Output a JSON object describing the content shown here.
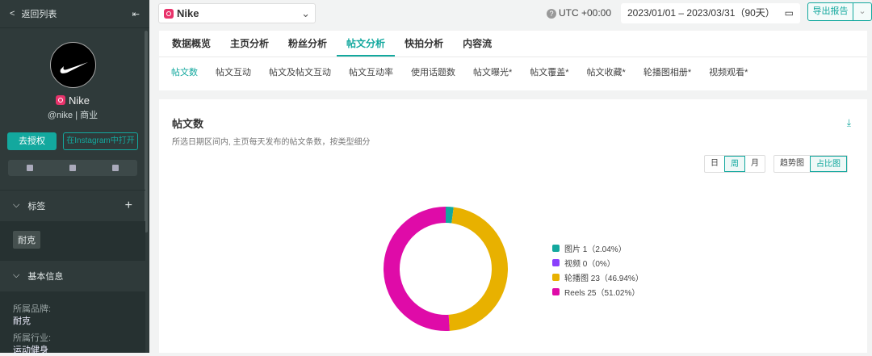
{
  "sidebar": {
    "back": "返回列表",
    "name": "Nike",
    "handle": "@nike | 商业",
    "authorize": "去授权",
    "open_ig": "在Instagram中打开",
    "tags_title": "标签",
    "tag": "耐克",
    "basic_title": "基本信息",
    "brand_label": "所属品牌:",
    "brand_value": "耐克",
    "industry_label": "所属行业:",
    "industry_value": "运动健身"
  },
  "topbar": {
    "brand": "Nike",
    "timezone": "UTC +00:00",
    "date_range": "2023/01/01 – 2023/03/31（90天）",
    "export": "导出报告"
  },
  "tabs": [
    "数据概览",
    "主页分析",
    "粉丝分析",
    "帖文分析",
    "快拍分析",
    "内容流"
  ],
  "subtabs": [
    "帖文数",
    "帖文互动",
    "帖文及帖文互动",
    "帖文互动率",
    "使用话题数",
    "帖文曝光*",
    "帖文覆盖*",
    "帖文收藏*",
    "轮播图相册*",
    "视频观看*"
  ],
  "card": {
    "title": "帖文数",
    "desc": "所选日期区间内, 主页每天发布的帖文条数，按类型细分",
    "period": [
      "日",
      "周",
      "月"
    ],
    "view": [
      "趋势图",
      "占比图"
    ]
  },
  "chart_data": {
    "type": "pie",
    "donut": true,
    "series": [
      {
        "name": "图片",
        "value": 1,
        "pct": "2.04%",
        "label": "图片 1（2.04%）",
        "color": "#13a89e"
      },
      {
        "name": "视频",
        "value": 0,
        "pct": "0%",
        "label": "视频 0（0%）",
        "color": "#8a3ffc"
      },
      {
        "name": "轮播图",
        "value": 23,
        "pct": "46.94%",
        "label": "轮播图 23（46.94%）",
        "color": "#e8b100"
      },
      {
        "name": "Reels",
        "value": 25,
        "pct": "51.02%",
        "label": "Reels 25（51.02%）",
        "color": "#df0ba8"
      }
    ]
  }
}
